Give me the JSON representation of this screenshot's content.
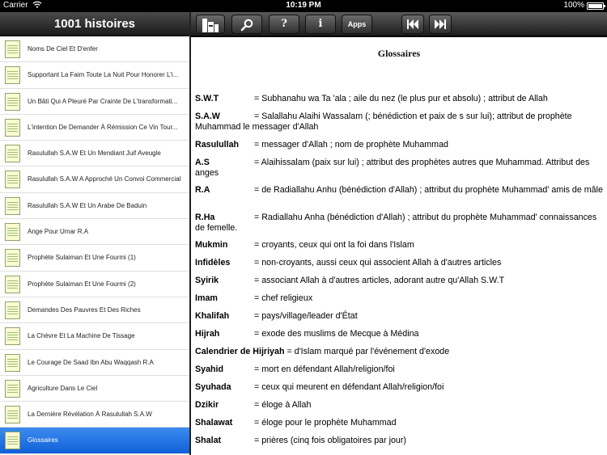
{
  "status": {
    "carrier": "Carrier",
    "time": "10:19 PM",
    "battery": "100%"
  },
  "sidebar": {
    "title": "1001 histoires",
    "items": [
      {
        "label": "Noms De Ciel Et D'enfer"
      },
      {
        "label": "Supportant La Faim Toute La Nuit Pour Honorer L'i..."
      },
      {
        "label": "Un Bâti Qui A Pleuré Par Crainte De L'transformati..."
      },
      {
        "label": "L'intention De Demander À Rémission Ce Vin Tour..."
      },
      {
        "label": "Rasulullah S.A.W Et Un Mendiant Juif Aveugle"
      },
      {
        "label": "Rasulullah S.A.W A Approché Un Convoi Commercial"
      },
      {
        "label": "Rasulullah S.A.W Et Un Arabe De Baduin"
      },
      {
        "label": "Ange Pour Umar R.A"
      },
      {
        "label": "Prophète Sulaiman Et Une Fourmi (1)"
      },
      {
        "label": "Prophète Sulaiman Et Une Fourmi (2)"
      },
      {
        "label": "Demandes Des Pauvres Et Des Riches"
      },
      {
        "label": "La Chèvre Et La Machine De Tissage"
      },
      {
        "label": "Le Courage De Saad Ibn Abu Waqqash R.A"
      },
      {
        "label": "Agriculture Dans Le Ciel"
      },
      {
        "label": "La Dernière Révélation À Rasulullah S.A.W"
      },
      {
        "label": "Glossaires"
      }
    ],
    "selected_index": 15
  },
  "toolbar": {
    "help_label": "?",
    "info_label": "i",
    "apps_label": "Apps"
  },
  "content": {
    "title": "Glossaires",
    "entries": [
      {
        "term": "S.W.T",
        "def": "= Subhanahu wa Ta 'ala ; aile du nez (le plus pur et absolu) ; attribut de Allah"
      },
      {
        "term": "S.A.W",
        "def": "= Salallahu Alaihi Wassalam (; bénédiction et paix de s sur lui); attribut de prophète Muhammad le messager d'Allah"
      },
      {
        "term": "Rasulullah",
        "def": "= messager d'Allah ; nom de prophète Muhammad"
      },
      {
        "term": "A.S",
        "def": "= Alaihissalam (paix sur lui) ; attribut des prophètes autres que Muhammad. Attribut des anges"
      },
      {
        "term": "R.A",
        "def": "= de Radiallahu Anhu (bénédiction d'Allah) ; attribut du prophète Muhammad' amis de mâle"
      },
      {
        "term": "R.Ha",
        "def": "= Radiallahu Anha (bénédiction d'Allah) ; attribut du prophète Muhammad' connaissances de femelle."
      },
      {
        "term": "Mukmin",
        "def": "= croyants, ceux qui ont la foi dans l'Islam"
      },
      {
        "term": "Infidèles",
        "def": "= non-croyants, aussi ceux qui associent Allah à d'autres articles"
      },
      {
        "term": "Syirik",
        "def": "= associant Allah à d'autres articles, adorant autre qu'Allah S.W.T"
      },
      {
        "term": "Imam",
        "def": "= chef religieux"
      },
      {
        "term": "Khalifah",
        "def": "= pays/village/leader d'État"
      },
      {
        "term": "Hijrah",
        "def": "= exode des muslims de Mecque à Médina"
      },
      {
        "term": "Calendrier de Hijriyah",
        "def": "= d'Islam marqué par l'événement d'exode"
      },
      {
        "term": "Syahid",
        "def": "= mort en défendant Allah/religion/foi"
      },
      {
        "term": "Syuhada",
        "def": "= ceux qui meurent en défendant Allah/religion/foi"
      },
      {
        "term": "Dzikir",
        "def": "= éloge à Allah"
      },
      {
        "term": "Shalawat",
        "def": "= éloge pour le prophète Muhammad"
      },
      {
        "term": "Shalat",
        "def": "= prières (cinq fois obligatoires par jour)"
      }
    ]
  }
}
